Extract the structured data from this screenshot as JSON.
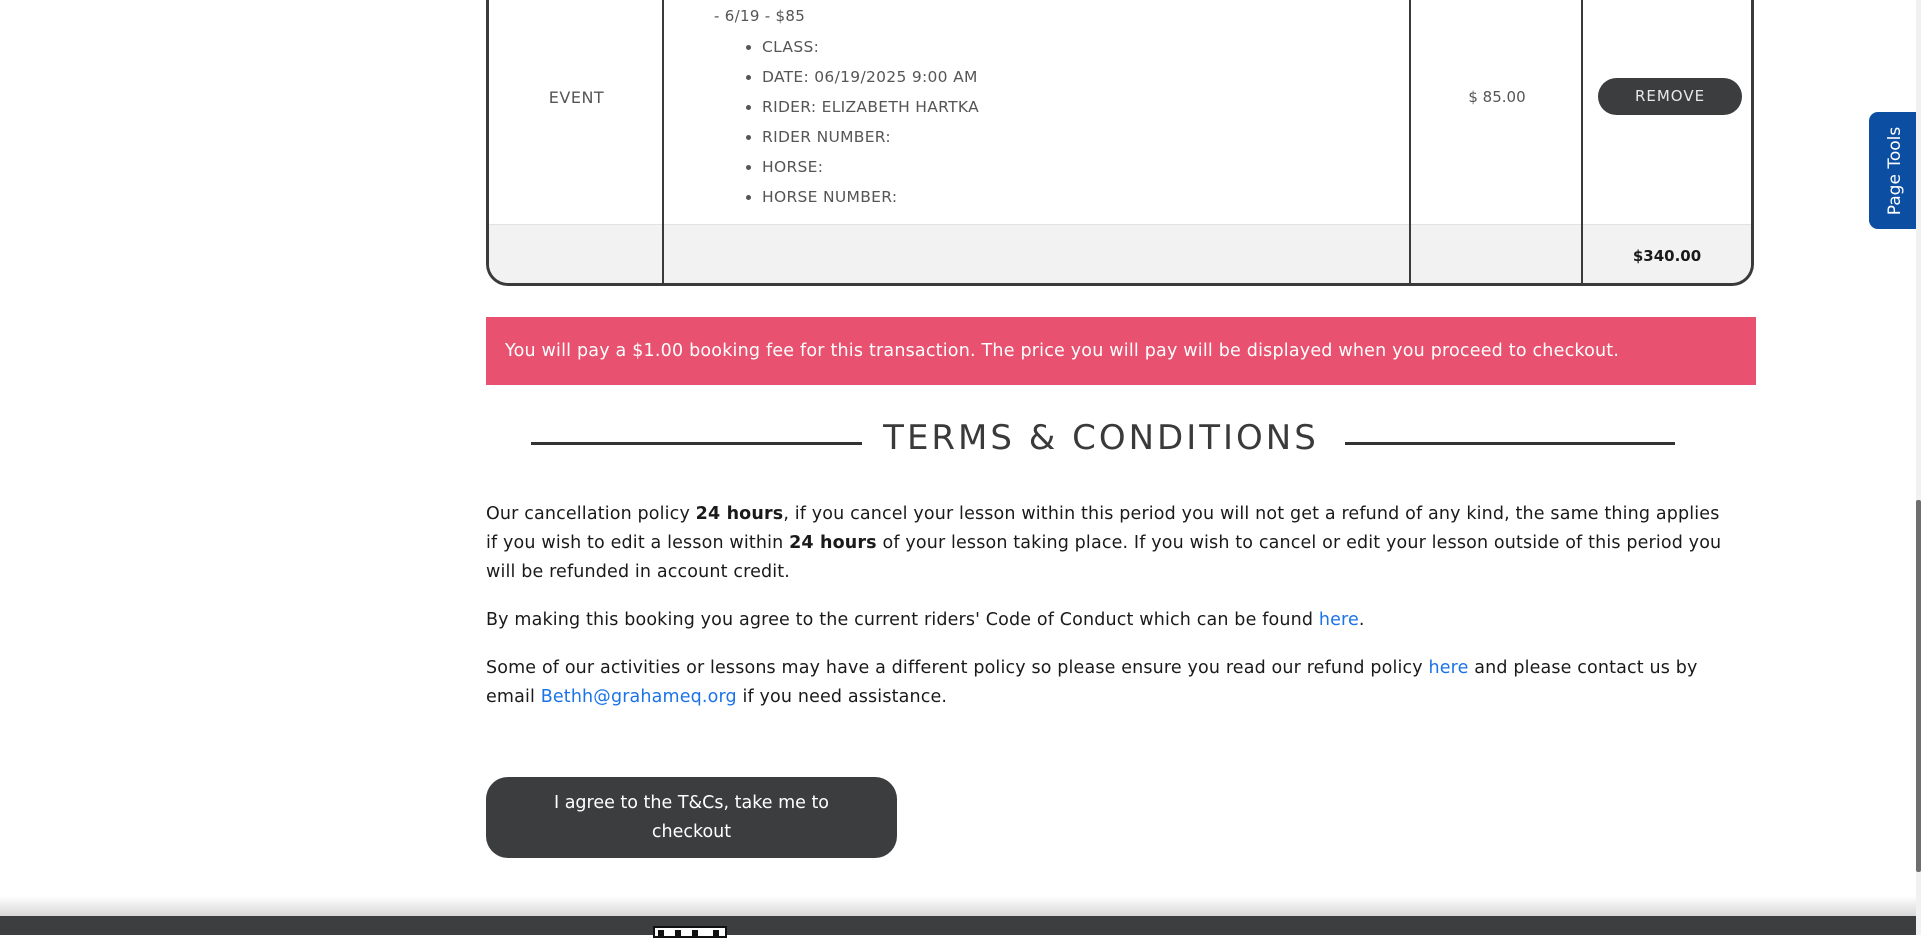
{
  "cart": {
    "row": {
      "type": "EVENT",
      "date_price": "- 6/19 - $85",
      "details": [
        "CLASS:",
        "DATE: 06/19/2025 9:00 AM",
        "RIDER: ELIZABETH HARTKA",
        "RIDER NUMBER:",
        "HORSE:",
        "HORSE NUMBER:"
      ],
      "price": "$ 85.00",
      "remove_label": "REMOVE"
    },
    "total": "$340.00"
  },
  "fee_notice": "You will pay a $1.00 booking fee for this transaction. The price you will pay will be displayed when you proceed to checkout.",
  "terms": {
    "title": "TERMS & CONDITIONS",
    "p1_a": "Our cancellation policy ",
    "p1_b": "24 hours",
    "p1_c": ", if you cancel your lesson within this period you will not get a refund of any kind, the same thing applies if you wish to edit a lesson within ",
    "p1_d": "24 hours",
    "p1_e": " of your lesson taking place. If you wish to cancel or edit your lesson outside of this period you will be refunded in account credit.",
    "p2_a": "By making this booking you agree to the current riders' Code of Conduct which can be found ",
    "p2_link": "here",
    "p2_b": ".",
    "p3_a": "Some of our activities or lessons may have a different policy so please ensure you read our refund policy ",
    "p3_link": "here",
    "p3_b": " and please contact us by email ",
    "p3_email": "Bethh@grahameq.org",
    "p3_c": " if you need assistance."
  },
  "agree_button": "I agree to the T&Cs, take me to checkout",
  "page_tools": "Page Tools",
  "colors": {
    "banner": "#e8516f",
    "button_dark": "#3b3d3e",
    "link": "#1a73e8",
    "page_tools": "#0b4ea2",
    "footer": "#3c3e40"
  }
}
